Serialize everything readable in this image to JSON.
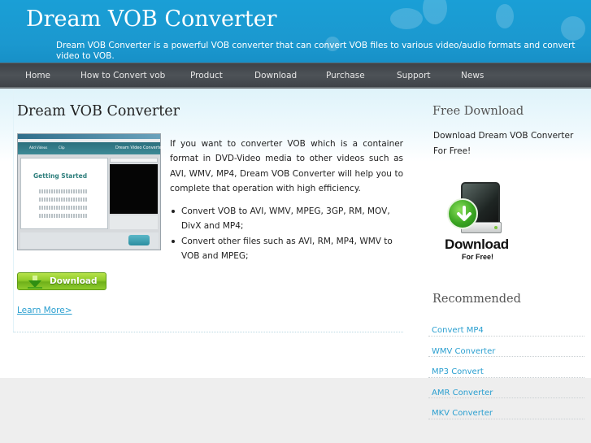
{
  "header": {
    "site_title": "Dream VOB Converter",
    "tagline": "Dream VOB Converter is a powerful VOB converter that can convert VOB files to various video/audio formats and convert video to VOB."
  },
  "nav": {
    "items": [
      {
        "label": "Home"
      },
      {
        "label": "How to Convert vob"
      },
      {
        "label": "Product"
      },
      {
        "label": "Download"
      },
      {
        "label": "Purchase"
      },
      {
        "label": "Support"
      },
      {
        "label": "News"
      }
    ]
  },
  "main": {
    "title": "Dream VOB Converter",
    "screenshot": {
      "app_title": "Dream Video Converter",
      "toolbar_add": "Add Videos",
      "toolbar_clip": "Clip",
      "getting_started": "Getting Started"
    },
    "intro": "If you want to converter VOB which is a container format in DVD-Video media to other videos such as AVI, WMV, MP4, Dream VOB Converter will help you to complete that operation with high efficiency.",
    "features": [
      "Convert VOB to AVI, WMV, MPEG, 3GP, RM, MOV, DivX and MP4;",
      "Convert other files such as AVI, RM, MP4, WMV to VOB and MPEG;"
    ],
    "download_button": "Download",
    "learn_more": "Learn More>"
  },
  "sidebar": {
    "free_download": {
      "title": "Free Download",
      "text": "Download Dream VOB Converter For Free!",
      "graphic_big": "Download",
      "graphic_small": "For Free!"
    },
    "recommended": {
      "title": "Recommended",
      "links": [
        {
          "label": "Convert MP4"
        },
        {
          "label": "WMV Converter"
        },
        {
          "label": "MP3 Convert"
        },
        {
          "label": "AMR Converter"
        },
        {
          "label": "MKV Converter"
        }
      ]
    }
  },
  "colors": {
    "header_blue": "#1a9fd6",
    "nav_dark": "#45494e",
    "link_blue": "#2a9fd0",
    "download_green": "#8fcb2a",
    "footer_gray": "#eeeeee"
  }
}
